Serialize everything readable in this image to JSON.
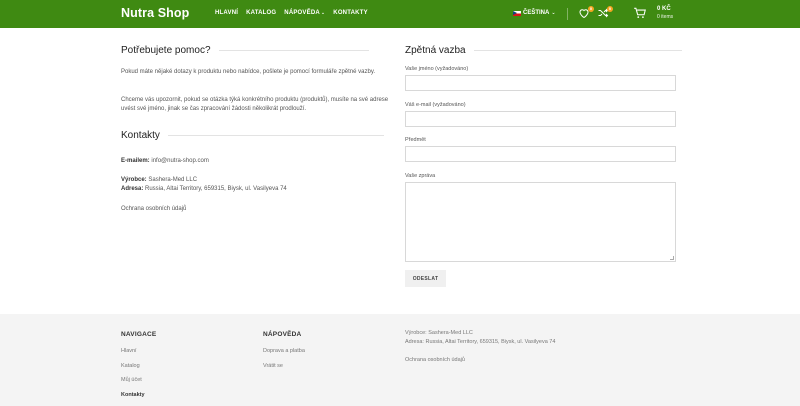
{
  "header": {
    "logo": "Nutra Shop",
    "nav": [
      {
        "label": "HLAVNÍ"
      },
      {
        "label": "KATALOG"
      },
      {
        "label": "NÁPOVĚDA"
      },
      {
        "label": "KONTAKTY"
      }
    ],
    "nav_caret": "⌄",
    "language": "ČEŠTINA",
    "wishlist_count": "0",
    "compare_count": "0",
    "cart_total": "0 KČ",
    "cart_items": "0 items"
  },
  "help": {
    "title": "Potřebujete pomoc?",
    "text1": "Pokud máte nějaké dotazy k produktu nebo nabídce, pošlete je pomocí formuláře zpětné vazby.",
    "text2": "Chceme vás upozornit, pokud se otázka týká konkrétního produktu (produktů), musíte na své adrese uvést své jméno, jinak se čas zpracování žádosti několikrát prodlouží."
  },
  "contacts": {
    "title": "Kontakty",
    "email_label": "E-mailem:",
    "email": "info@nutra-shop.com",
    "producer_label": "Výrobce:",
    "producer": "Sashera-Med LLC",
    "address_label": "Adresa:",
    "address": "Russia, Altai Territory, 659315, Biysk, ul. Vasilyeva 74",
    "privacy": "Ochrana osobních údajů"
  },
  "feedback": {
    "title": "Zpětná vazba",
    "name_label": "Vaše jméno (vyžadováno)",
    "email_label": "Váš e-mail (vyžadováno)",
    "subject_label": "Předmět",
    "message_label": "Vaše zpráva",
    "submit": "ODESLAT"
  },
  "footer": {
    "nav_title": "NAVIGACE",
    "nav_links": [
      "Hlavní",
      "Katalog",
      "Můj účet",
      "Kontakty"
    ],
    "help_title": "NÁPOVĚDA",
    "help_links": [
      "Doprava a platba",
      "Vrátit se"
    ],
    "producer_line": "Výrobce: Sashera-Med LLC",
    "address_line": "Adresa: Russia, Altai Territory, 659315, Biysk, ul. Vasilyeva 74",
    "privacy": "Ochrana osobních údajů"
  },
  "colors": {
    "header_bg": "#3f8a12",
    "badge": "#f5a623",
    "footer_bg": "#f4f4f4"
  }
}
